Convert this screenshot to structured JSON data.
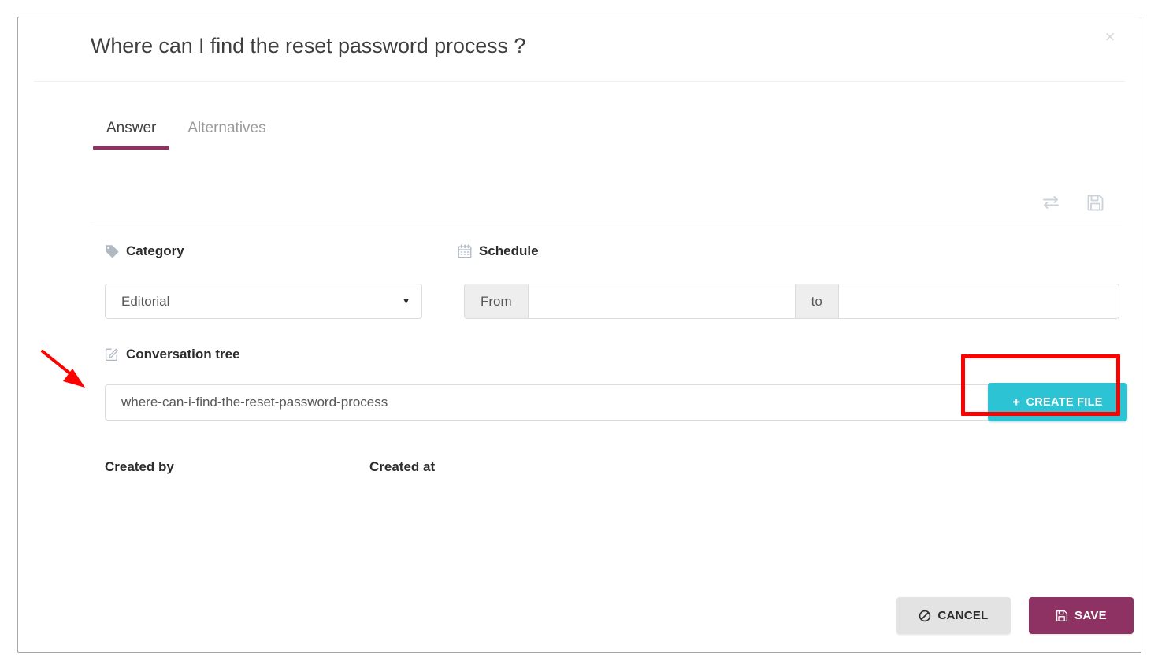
{
  "dialog": {
    "title": "Where can I find the reset password process ?",
    "close_label": "×"
  },
  "tabs": [
    {
      "label": "Answer",
      "active": true
    },
    {
      "label": "Alternatives",
      "active": false
    }
  ],
  "toolbar": {
    "icons": [
      {
        "name": "exchange-icon",
        "title": "Exchange"
      },
      {
        "name": "save-icon",
        "title": "Save"
      }
    ]
  },
  "form": {
    "category": {
      "label": "Category",
      "icon": "tag-icon",
      "value": "Editorial",
      "caret": "▼",
      "options": [
        "Editorial"
      ]
    },
    "schedule": {
      "label": "Schedule",
      "icon": "calendar-icon",
      "from_addon": "From",
      "to_addon": "to",
      "from_value": "",
      "to_value": "",
      "from_placeholder": "",
      "to_placeholder": ""
    },
    "conversation_tree": {
      "label": "Conversation tree",
      "icon": "edit-square-icon",
      "value": "where-can-i-find-the-reset-password-process",
      "placeholder": ""
    },
    "create_file_button": {
      "label": "CREATE FILE",
      "plus": "+"
    },
    "meta": {
      "created_by_label": "Created by",
      "created_at_label": "Created at",
      "created_by_value": "",
      "created_at_value": ""
    }
  },
  "footer": {
    "cancel_label": "CANCEL",
    "save_label": "SAVE"
  },
  "colors": {
    "accent_purple": "#8E3163",
    "cyan": "#2CC3D4",
    "annotation_red": "#FF0000",
    "cancel_gray": "#E3E3E3",
    "icon_gray": "#CCD2DA",
    "border_gray": "#DCDCDE"
  },
  "annotations": {
    "highlight_box": "create-file-button",
    "arrow": "points-to-conversation-tree-input"
  }
}
